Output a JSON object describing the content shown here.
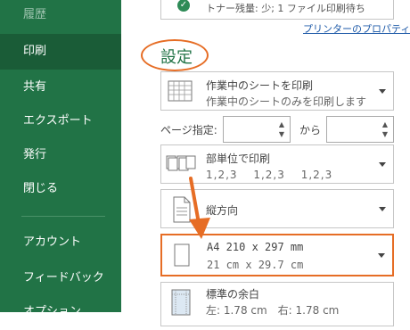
{
  "sidebar": {
    "items": [
      {
        "label": "履歴",
        "faded": true
      },
      {
        "label": "印刷",
        "active": true
      },
      {
        "label": "共有"
      },
      {
        "label": "エクスポート"
      },
      {
        "label": "発行"
      },
      {
        "label": "閉じる"
      },
      {
        "label": "アカウント"
      },
      {
        "label": "フィードバック"
      },
      {
        "label": "オプション"
      }
    ]
  },
  "printer": {
    "status_text": "トナー残量: 少; 1 ファイル印刷待ち",
    "properties_link": "プリンターのプロパティ"
  },
  "settings": {
    "heading": "設定",
    "print_scope": {
      "title": "作業中のシートを印刷",
      "subtitle": "作業中のシートのみを印刷します"
    },
    "pages": {
      "label": "ページ指定:",
      "from_value": "",
      "to_label": "から",
      "to_value": ""
    },
    "collation": {
      "title": "部単位で印刷",
      "subtitle": "1,2,3　 1,2,3　 1,2,3"
    },
    "orientation": {
      "title": "縦方向"
    },
    "paper_size": {
      "title": "A4 210 x 297 mm",
      "subtitle": "21 cm x 29.7 cm"
    },
    "margins": {
      "title": "標準の余白",
      "subtitle": "左: 1.78 cm　右: 1.78 cm"
    }
  },
  "colors": {
    "sidebar": "#217346",
    "sidebar_active": "#1a5c37",
    "accent_orange": "#e66d25",
    "link_blue": "#1e5aa8"
  }
}
